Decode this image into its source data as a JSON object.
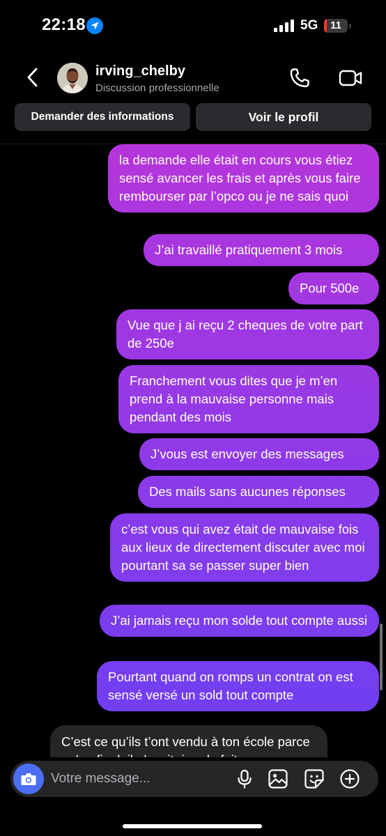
{
  "status_bar": {
    "time": "22:18",
    "network": "5G",
    "battery": "11",
    "battery_level": 0.11,
    "battery_color": "#ff3b30"
  },
  "header": {
    "username": "irving_chelby",
    "subtitle": "Discussion professionnelle",
    "request_info_button": "Demander des informations",
    "view_profile_button": "Voir le profil"
  },
  "messages": [
    {
      "sender": "me",
      "text": "la demande elle était en cours vous étiez sensé avancer les frais et après vous faire rembourser par l’opco ou je ne sais quoi"
    },
    {
      "sender": "me",
      "text": "J’ai travaillé pratiquement 3 mois"
    },
    {
      "sender": "me",
      "text": "Pour 500e"
    },
    {
      "sender": "me",
      "text": "Vue que j ai reçu 2 cheques de votre part de 250e"
    },
    {
      "sender": "me",
      "text": "Franchement vous dites que je m’en prend à la mauvaise personne mais pendant des mois"
    },
    {
      "sender": "me",
      "text": "J’vous est envoyer des messages"
    },
    {
      "sender": "me",
      "text": "Des mails sans aucunes réponses"
    },
    {
      "sender": "me",
      "text": "c’est vous qui avez était de mauvaise fois aux lieux de directement discuter avec moi pourtant sa se passer super bien"
    },
    {
      "sender": "me",
      "text": "J’ai jamais reçu mon solde tout compte aussi"
    },
    {
      "sender": "me",
      "text": "Pourtant quand on romps un contrat on est sensé versé un sold tout compte"
    },
    {
      "sender": "them",
      "text": "C’est ce qu’ils t’ont vendu à ton école parce qu’au final, il n’avait rien de fait"
    }
  ],
  "composer": {
    "placeholder": "Votre message..."
  },
  "colors": {
    "gradient_top": "#b535db",
    "gradient_bottom": "#6b3ff4",
    "incoming_bubble": "#262628",
    "camera_button": "#4c6ef5"
  },
  "icons": [
    "location-arrow-icon",
    "signal-icon",
    "back-chevron-icon",
    "phone-icon",
    "video-camera-icon",
    "camera-icon",
    "microphone-icon",
    "gallery-icon",
    "sticker-icon",
    "plus-icon"
  ]
}
